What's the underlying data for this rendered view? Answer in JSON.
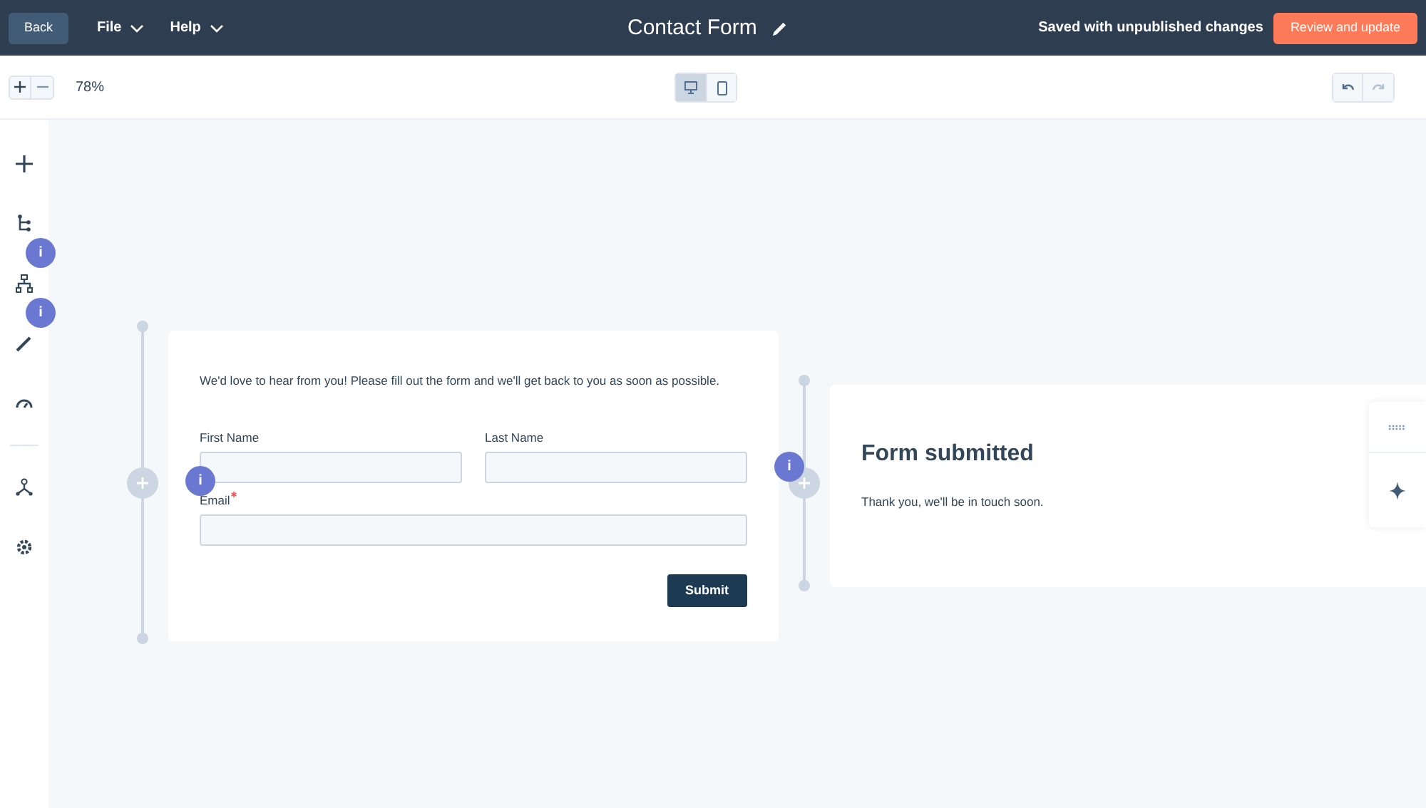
{
  "top_bar": {
    "back": "Back",
    "menus": [
      {
        "label": "File"
      },
      {
        "label": "Help"
      }
    ],
    "title": "Contact Form",
    "status": "Saved with unpublished changes",
    "primary_button": "Review and update"
  },
  "toolbar": {
    "zoom": "78%",
    "devices": [
      {
        "kind": "desktop",
        "selected": true
      },
      {
        "kind": "mobile",
        "selected": false
      }
    ],
    "undo": {
      "disabled": false
    },
    "redo": {
      "disabled": true
    }
  },
  "sidebar": {
    "items": [
      {
        "kind": "add"
      },
      {
        "kind": "tree"
      },
      {
        "kind": "hierarchy"
      },
      {
        "kind": "brush"
      },
      {
        "kind": "gauge"
      },
      {
        "kind": "divider"
      },
      {
        "kind": "flow"
      },
      {
        "kind": "gear"
      }
    ]
  },
  "info_badges": [
    {
      "text": "i"
    },
    {
      "text": "i"
    },
    {
      "text": "i"
    },
    {
      "text": "i"
    }
  ],
  "form": {
    "intro": "We'd love to hear from you! Please fill out the form and we'll get back to you as soon as possible.",
    "fields": [
      {
        "label": "First Name",
        "required": false,
        "kind": "half"
      },
      {
        "label": "Last Name",
        "required": false,
        "kind": "half"
      },
      {
        "label": "Email",
        "required": true,
        "kind": "full"
      }
    ],
    "submit": "Submit"
  },
  "confirmation": {
    "title": "Form submitted",
    "message": "Thank you, we'll be in touch soon."
  }
}
